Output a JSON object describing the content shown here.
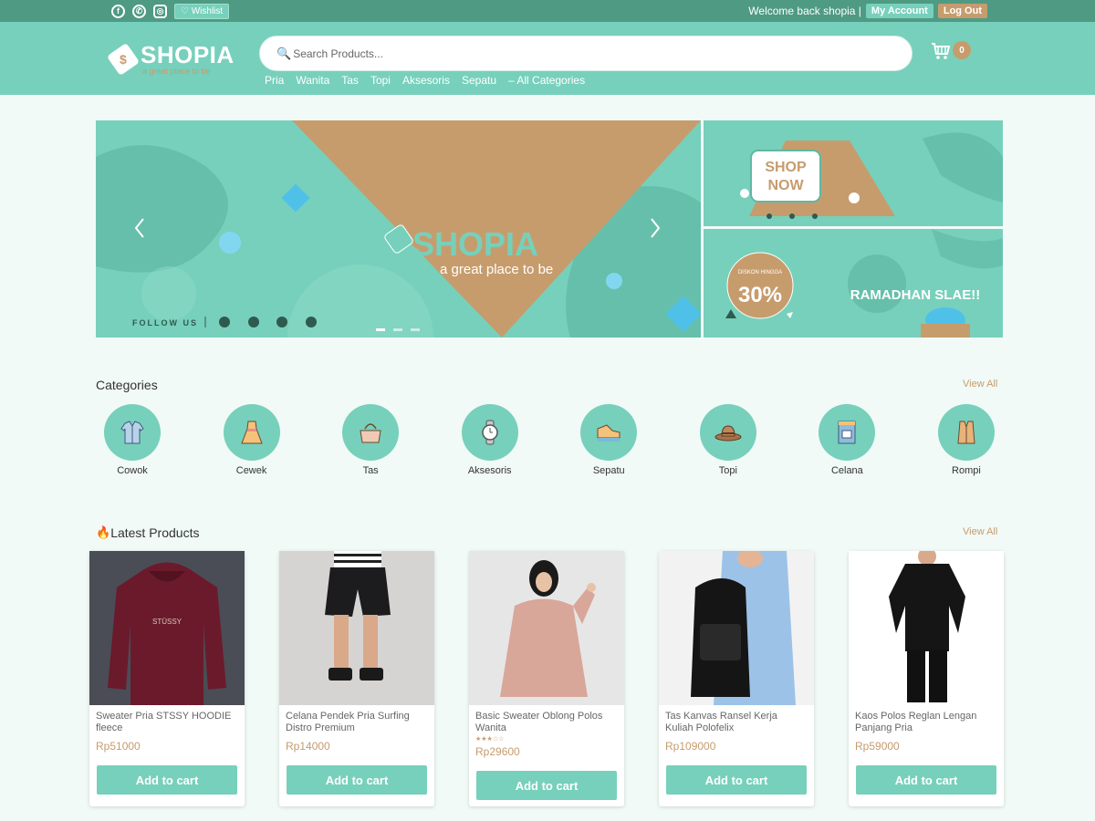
{
  "topbar": {
    "wishlist_label": "♡ Wishlist",
    "welcome_text": "Welcome back shopia |",
    "account_label": "My Account",
    "logout_label": "Log Out"
  },
  "header": {
    "logo_text": "SHOPIA",
    "logo_tagline": "a great place to be",
    "search_placeholder": "Search Products...",
    "cart_count": "0",
    "nav": [
      "Pria",
      "Wanita",
      "Tas",
      "Topi",
      "Aksesoris",
      "Sepatu",
      "– All Categories"
    ]
  },
  "banner_main": {
    "brand": "SHOPIA",
    "tagline": "a great place to be",
    "follow_label": "FOLLOW US"
  },
  "banner_side1": {
    "cta": "SHOP NOW"
  },
  "banner_side2": {
    "discount_label": "DISKON HINGGA",
    "discount_value": "30%",
    "promo_text": "RAMADHAN SLAE!!"
  },
  "categories": {
    "title": "Categories",
    "view_all": "View All",
    "items": [
      "Cowok",
      "Cewek",
      "Tas",
      "Aksesoris",
      "Sepatu",
      "Topi",
      "Celana",
      "Rompi"
    ]
  },
  "latest": {
    "title": "Latest Products",
    "view_all": "View All",
    "add_label": "Add to cart",
    "products": [
      {
        "name": "Sweater Pria STSSY HOODIE fleece",
        "price": "Rp51000"
      },
      {
        "name": "Celana Pendek Pria Surfing Distro Premium",
        "price": "Rp14000"
      },
      {
        "name": "Basic Sweater Oblong Polos Wanita",
        "price": "Rp29600",
        "stars": "★★★☆☆"
      },
      {
        "name": "Tas Kanvas Ransel Kerja Kuliah Polofelix",
        "price": "Rp109000"
      },
      {
        "name": "Kaos Polos Reglan Lengan Panjang Pria",
        "price": "Rp59000"
      }
    ]
  },
  "colors": {
    "primary": "#77d0bb",
    "accent": "#c69c6d",
    "topbar": "#4f9a83",
    "background": "#f1faf6"
  }
}
